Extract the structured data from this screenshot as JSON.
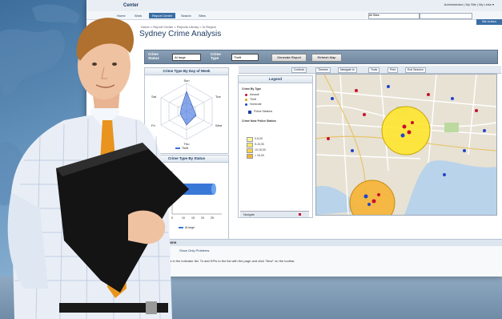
{
  "screen": {
    "app_title": "Center",
    "user_info": "Administrator  |  My Site  |  My Links ▾",
    "nav_tabs": [
      "Home",
      "Work",
      "Report Center",
      "Search",
      "Sites"
    ],
    "active_tab": "Report Center",
    "search_scope": "All Sites",
    "site_actions": "Site Actions",
    "breadcrumb": "Home > Report Center > Reports Library > In Region",
    "page_title": "Sydney Crime Analysis",
    "filters": {
      "crime_status_label": "Crime Status",
      "crime_status_value": "At large",
      "crime_type_label": "Crime Type",
      "crime_type_value": "Theft",
      "generate_button": "Generate Report",
      "refresh_button": "Refresh Map"
    },
    "map_toolbar": [
      "Controls",
      "Themes",
      "Navigate to",
      "Tools",
      "Print",
      "End Session"
    ],
    "radar_chart": {
      "title": "Crime Type By Day of Week",
      "days": [
        "Sun",
        "Tue",
        "Wed",
        "Thu",
        "Fri",
        "Sat"
      ],
      "legend": "Theft"
    },
    "bar_chart": {
      "title": "Crime Type By Status",
      "ticks": [
        "0",
        "10",
        "15",
        "20",
        "25"
      ],
      "legend": "At large"
    },
    "legend_panel": {
      "title": "Legend",
      "crime_by_type": "Crime By Type",
      "types": [
        "Assault",
        "Theft",
        "Homicide"
      ],
      "police_station": "Police Stations",
      "rings_title": "Crime Near Police Station",
      "rings": [
        "0-5,00",
        "5-10,00",
        "10-15,00",
        "> 15,00"
      ],
      "navigate": "Navigate"
    },
    "notifications": "Your Notifications",
    "notifications_text": "There are no KPIs in the indicator list. To add KPIs to the list with the page and click \"New\" on the toolbar.",
    "actions_label": "Actions",
    "show_problems": "Show Only Problems"
  }
}
